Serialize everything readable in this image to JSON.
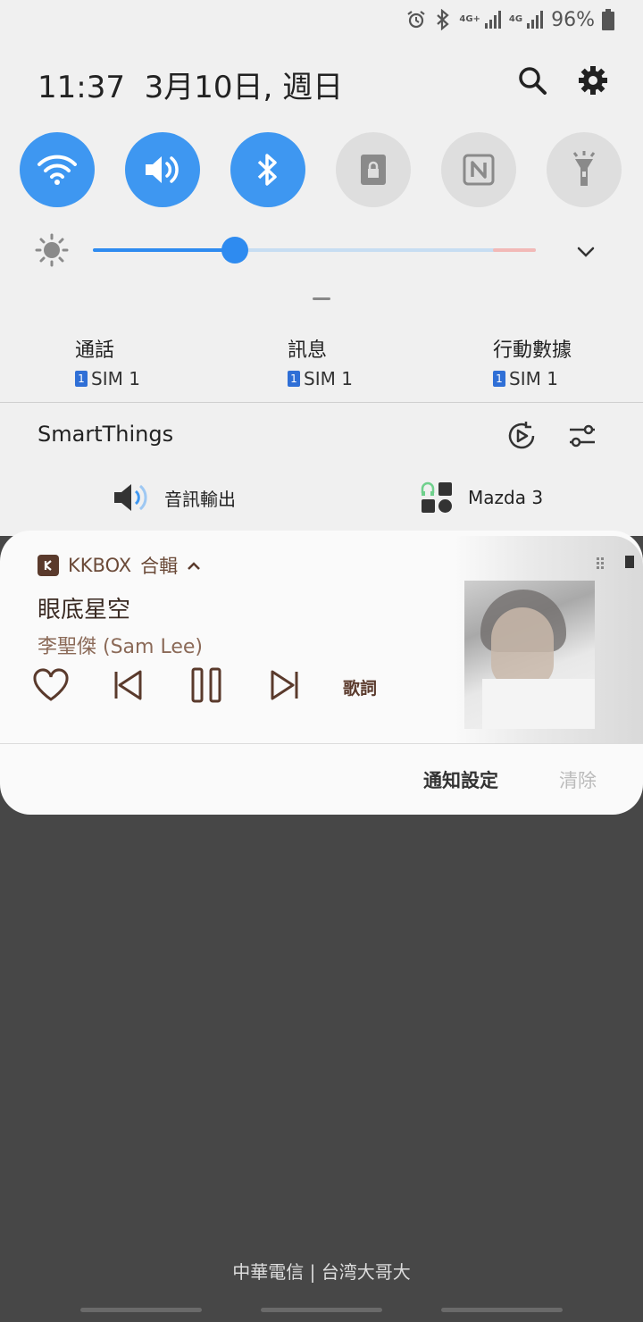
{
  "status_bar": {
    "network_1": "4G+",
    "network_2": "4G",
    "battery_percent": "96%",
    "icons": [
      "alarm-icon",
      "bluetooth-icon",
      "signal-icon",
      "battery-icon"
    ]
  },
  "header": {
    "time": "11:37",
    "date": "3月10日, 週日"
  },
  "quick_settings": {
    "toggles": [
      {
        "name": "wifi",
        "state": "on"
      },
      {
        "name": "sound",
        "state": "on"
      },
      {
        "name": "bluetooth",
        "state": "on"
      },
      {
        "name": "screen-rotation-lock",
        "state": "off"
      },
      {
        "name": "nfc",
        "state": "off"
      },
      {
        "name": "flashlight",
        "state": "off"
      }
    ],
    "accent_color": "#3e97f1",
    "brightness_level": 0.32
  },
  "sim": [
    {
      "title": "通話",
      "badge": "1",
      "sim": "SIM 1"
    },
    {
      "title": "訊息",
      "badge": "1",
      "sim": "SIM 1"
    },
    {
      "title": "行動數據",
      "badge": "1",
      "sim": "SIM 1"
    }
  ],
  "smartthings": {
    "title": "SmartThings",
    "devices": [
      {
        "label": "音訊輸出"
      },
      {
        "label": "Mazda 3"
      }
    ]
  },
  "notification": {
    "app_name": "KKBOX",
    "subtext": "合輯",
    "song": "眼底星空",
    "artist": "李聖傑 (Sam Lee)",
    "lyrics_label": "歌詞",
    "settings_label": "通知設定",
    "clear_label": "清除",
    "accent_color": "#5a3a2c"
  },
  "carrier": "中華電信 | 台湾大哥大"
}
